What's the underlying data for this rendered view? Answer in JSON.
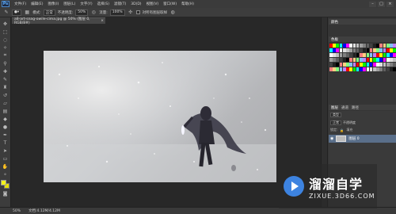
{
  "menu": {
    "logo": "Ps",
    "items": [
      "文件(F)",
      "编辑(E)",
      "图像(I)",
      "图层(L)",
      "文字(Y)",
      "选择(S)",
      "滤镜(T)",
      "3D(D)",
      "视图(V)",
      "窗口(W)",
      "帮助(H)"
    ]
  },
  "window": {
    "minimize": "–",
    "maximize": "□",
    "close": "×"
  },
  "options": {
    "mode_label": "模式:",
    "mode_value": "正常",
    "opacity_label": "不透明度:",
    "opacity_value": "50%",
    "flow_label": "流量:",
    "flow_value": "100%",
    "checkbox_label": "对所有图层取样"
  },
  "document": {
    "tab_title": "a8-art-snag-owile-cima.jpg @ 50% (图层 0, RGB/8#)",
    "close": "×"
  },
  "status": {
    "zoom": "50%",
    "doc_size": "文档:4.12M/4.12M"
  },
  "panels": {
    "color_tab": "颜色",
    "swatches_tab": "色板",
    "layers_tab": "图层",
    "channels_tab": "通道",
    "paths_tab": "路径",
    "kind_label": "类型",
    "blend_value": "正常",
    "opacity_label": "不透明度",
    "lock_label": "锁定:",
    "fill_label": "填充",
    "layer_name": "图层 0",
    "swatch_colors": [
      "#ff0000",
      "#ffff00",
      "#00ff00",
      "#00ffff",
      "#0000ff",
      "#ff00ff",
      "#ffffff",
      "#e0e0e0",
      "#c0c0c0",
      "#a0a0a0",
      "#808080",
      "#606060",
      "#404040",
      "#202020",
      "#000000",
      "#ff8080",
      "#ffd080",
      "#80ff80",
      "#80c0ff",
      "#c080ff"
    ]
  },
  "watermark": {
    "title": "溜溜自学",
    "url": "ZIXUE.3D66.COM"
  }
}
